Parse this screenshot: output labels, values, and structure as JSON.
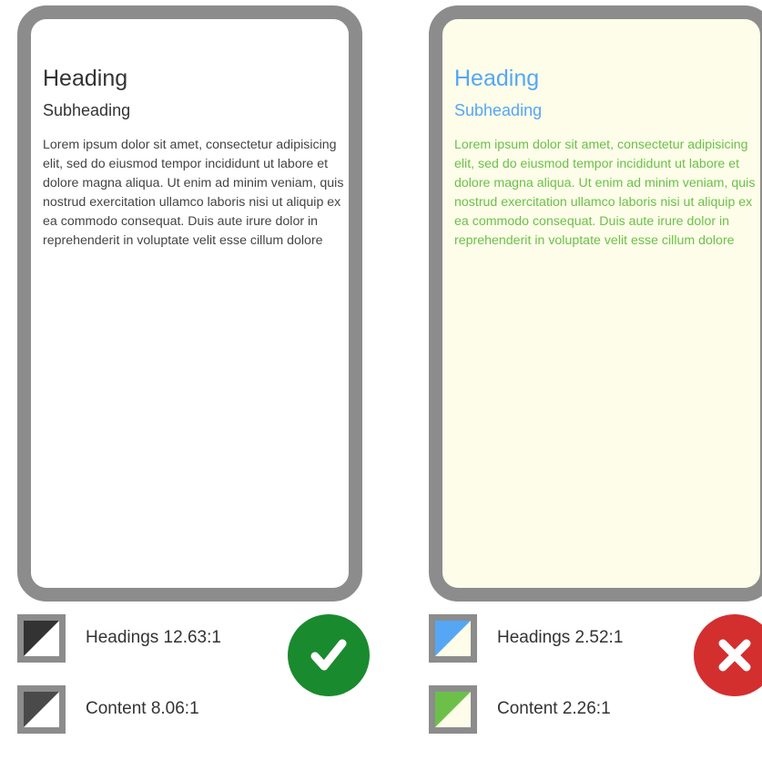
{
  "good_card": {
    "heading": "Heading",
    "subheading": "Subheading",
    "content": "Lorem ipsum dolor sit amet, consectetur adipisicing elit, sed do eiusmod tempor incididunt ut labore et dolore magna aliqua. Ut enim ad minim veniam, quis nostrud exercitation ullamco laboris nisi ut aliquip ex ea commodo consequat. Duis aute irure dolor in reprehenderit in voluptate velit esse cillum dolore",
    "background_color": "#ffffff",
    "heading_color": "#333333",
    "content_color": "#444444",
    "headings_label": "Headings 12.63:1",
    "content_label": "Content 8.06:1",
    "result_icon": "check-icon",
    "result_color": "#1a8a2e"
  },
  "bad_card": {
    "heading": "Heading",
    "subheading": "Subheading",
    "content": "Lorem ipsum dolor sit amet, consectetur adipisicing elit, sed do eiusmod tempor incididunt ut labore et dolore magna aliqua. Ut enim ad minim veniam, quis nostrud exercitation ullamco laboris nisi ut aliquip ex ea commodo consequat. Duis aute irure dolor in reprehenderit in voluptate velit esse cillum dolore",
    "background_color": "#fdfde9",
    "heading_color": "#55a7f5",
    "content_color": "#6cc04a",
    "headings_label": "Headings 2.52:1",
    "content_label": "Content 2.26:1",
    "result_icon": "cross-icon",
    "result_color": "#d32f2f"
  }
}
